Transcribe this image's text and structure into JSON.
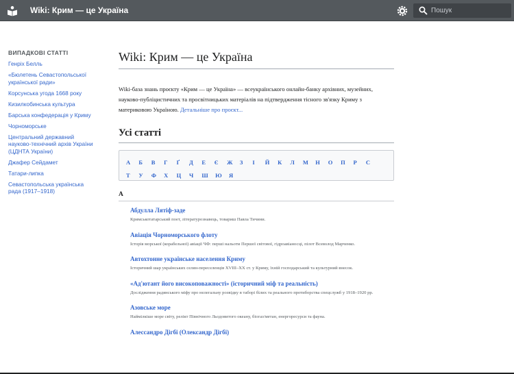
{
  "header": {
    "site_title": "Wiki: Крим — це Україна",
    "search_placeholder": "Пошук"
  },
  "sidebar": {
    "title": "ВИПАДКОВІ СТАТТІ",
    "items": [
      "Генріх Белль",
      "«Бюлетень Севастопольської української ради»",
      "Корсунська угода 1668 року",
      "Кизилкобинська культура",
      "Барська конфедерація у Криму",
      "Чорноморське",
      "Центральний державний науково-технічний архів України (ЦДНТА України)",
      "Джафер Сейдамет",
      "Татари-липка",
      "Севастопольська українська рада (1917–1918)"
    ]
  },
  "main": {
    "title": "Wiki: Крим — це Україна",
    "intro_text": "Wiki-база знань проєкту «Крим — це Україна» — всеукраїнського онлайн-банку архівних, музейних, науково-публіцистичних та просвітницьких матеріалів на підтвердження тісного зв'язку Криму з материковою Україною. ",
    "intro_link": "Детальніше про проєкт...",
    "section_title": "Усі статті",
    "letters_row1": [
      "А",
      "Б",
      "В",
      "Г",
      "Ґ",
      "Д",
      "Е",
      "Є",
      "Ж",
      "З",
      "І",
      "Й",
      "К",
      "Л",
      "М",
      "Н",
      "О",
      "П",
      "Р",
      "С"
    ],
    "letters_row2": [
      "Т",
      "У",
      "Ф",
      "Х",
      "Ц",
      "Ч",
      "Ш",
      "Ю",
      "Я"
    ],
    "current_letter": "А",
    "articles": [
      {
        "title": "Абдулла Лятіф-заде",
        "desc": "Кримськотатарський поет, літературознавець, товариш Павла Тичини."
      },
      {
        "title": "Авіація Чорноморського флоту",
        "desc": "Історія морської (корабельної) авіації ЧФ: перші нальоти Першої світової, гідроавіаносці, пілот Всеволод Марченко."
      },
      {
        "title": "Автохтонне українське населення Криму",
        "desc": "Історичний шар українських селян-переселенців XVIII–XX ст. у Криму, їхній господарський та культурний внесок."
      },
      {
        "title": "«Ад'ютант його високоповажності» (історичний міф та реальність)",
        "desc": "Дослідження радянського міфу про нелегальну розвідку в таборі білих та реального протиборства спецслужб у 1918–1920 рр."
      },
      {
        "title": "Азовське море",
        "desc": "Наймілкіше море світу, релікт Північного Льодовитого океану, біогаз/метан, енергоресурси та фауна."
      },
      {
        "title": "Алессандро Дігбі (Олександр Дігбі)",
        "desc": ""
      }
    ]
  }
}
